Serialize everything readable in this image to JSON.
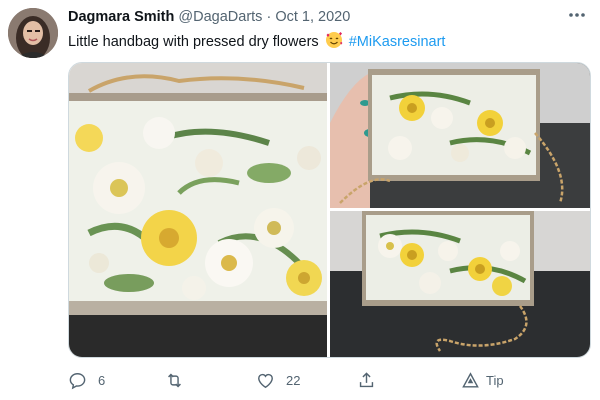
{
  "tweet": {
    "author_name": "Dagmara Smith",
    "author_handle": "@DagaDarts",
    "separator": "·",
    "date": "Oct 1, 2020",
    "text": "Little handbag with pressed dry flowers",
    "emoji_icon": "smiling-face-with-hearts-icon",
    "hashtag": "#MiKasresinart"
  },
  "actions": {
    "reply_count": "6",
    "retweet_count": "",
    "like_count": "22",
    "tip_label": "Tip"
  },
  "media": {
    "photo_count": 3,
    "subjects": [
      "resin-handbag-closeup",
      "handbag-held-in-hand",
      "handbag-on-table"
    ]
  },
  "colors": {
    "link": "#1d9bf0",
    "secondary_text": "#536471",
    "primary_text": "#0f1419",
    "border": "#cfd9de"
  }
}
